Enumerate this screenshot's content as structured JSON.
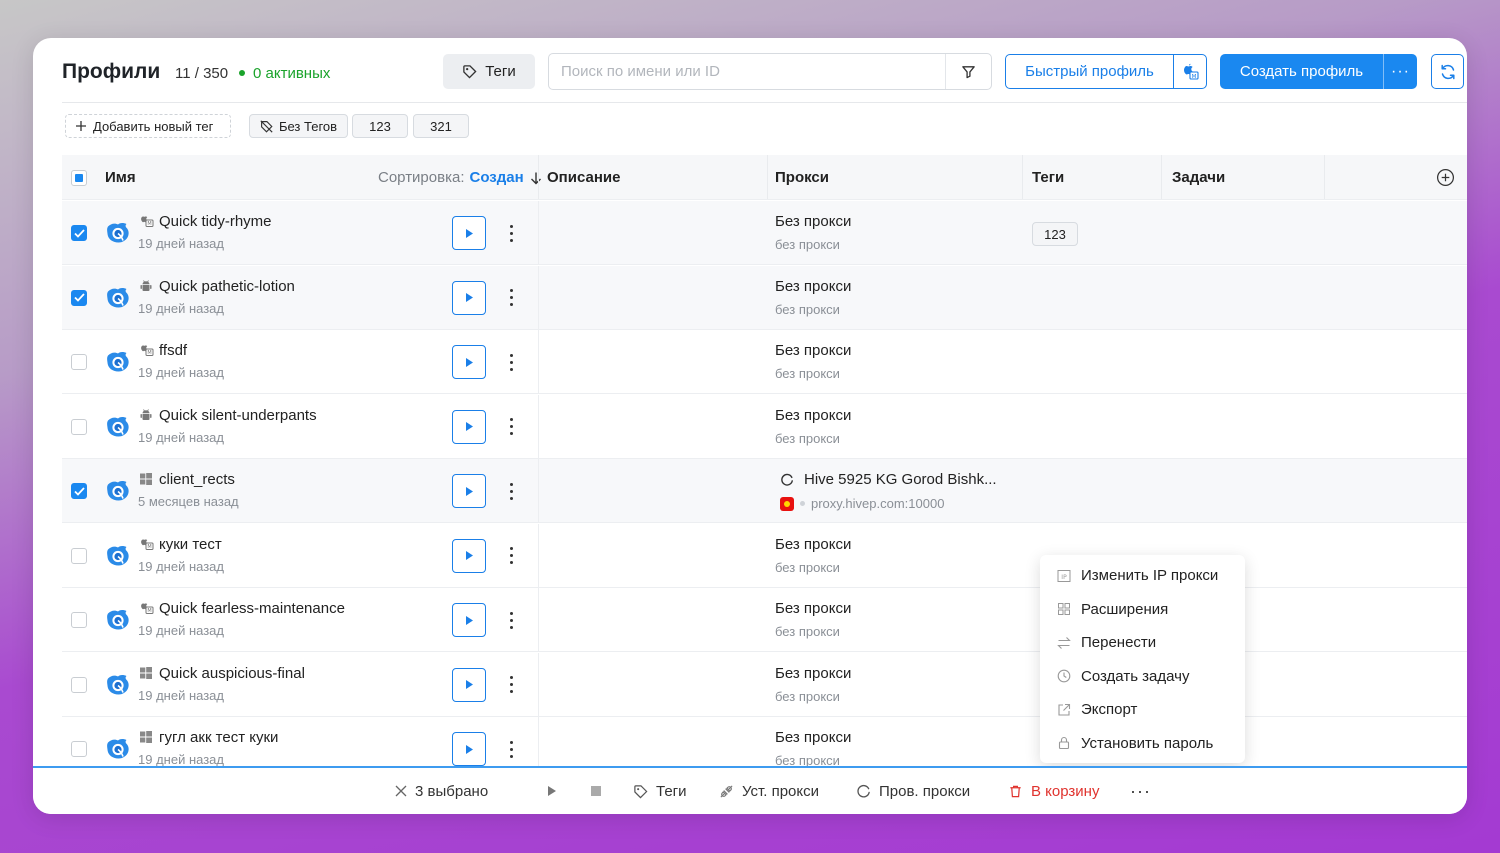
{
  "header": {
    "title": "Профили",
    "count": "11 / 350",
    "active": "0 активных",
    "tags_button": "Теги",
    "search_placeholder": "Поиск по имени или ID",
    "quick_profile": "Быстрый профиль",
    "create_profile": "Создать профиль",
    "create_more": "···"
  },
  "tagbar": {
    "add_tag": "Добавить новый тег",
    "no_tags": "Без Тегов",
    "tags": [
      "123",
      "321"
    ]
  },
  "table": {
    "columns": {
      "name": "Имя",
      "sort_label": "Сортировка:",
      "sort_value": "Создан",
      "description": "Описание",
      "proxy": "Прокси",
      "tags": "Теги",
      "tasks": "Задачи"
    },
    "rows": [
      {
        "name": "Quick tidy-rhyme",
        "date": "19 дней назад",
        "proxy": "Без прокси",
        "proxy_sub": "без прокси",
        "tag": "123",
        "checked": true,
        "os": "mac-icon"
      },
      {
        "name": "Quick pathetic-lotion",
        "date": "19 дней назад",
        "proxy": "Без прокси",
        "proxy_sub": "без прокси",
        "tag": "",
        "checked": true,
        "os": "android-icon"
      },
      {
        "name": "ffsdf",
        "date": "19 дней назад",
        "proxy": "Без прокси",
        "proxy_sub": "без прокси",
        "tag": "",
        "checked": false,
        "os": "mac-icon"
      },
      {
        "name": "Quick silent-underpants",
        "date": "19 дней назад",
        "proxy": "Без прокси",
        "proxy_sub": "без прокси",
        "tag": "",
        "checked": false,
        "os": "android-icon"
      },
      {
        "name": "client_rects",
        "date": "5 месяцев назад",
        "proxy": "Hive 5925 KG Gorod Bishk...",
        "proxy_sub": "proxy.hivep.com:10000",
        "tag": "",
        "checked": true,
        "os": "windows-icon"
      },
      {
        "name": "куки тест",
        "date": "19 дней назад",
        "proxy": "Без прокси",
        "proxy_sub": "без прокси",
        "tag": "",
        "checked": false,
        "os": "mac-icon"
      },
      {
        "name": "Quick fearless-maintenance",
        "date": "19 дней назад",
        "proxy": "Без прокси",
        "proxy_sub": "без прокси",
        "tag": "",
        "checked": false,
        "os": "mac-icon"
      },
      {
        "name": "Quick auspicious-final",
        "date": "19 дней назад",
        "proxy": "Без прокси",
        "proxy_sub": "без прокси",
        "tag": "",
        "checked": false,
        "os": "windows-icon"
      },
      {
        "name": "гугл акк тест куки",
        "date": "19 дней назад",
        "proxy": "Без прокси",
        "proxy_sub": "без прокси",
        "tag": "",
        "checked": false,
        "os": "windows-icon"
      }
    ]
  },
  "context_menu": {
    "items": [
      "Изменить IP прокси",
      "Расширения",
      "Перенести",
      "Создать задачу",
      "Экспорт",
      "Установить пароль"
    ]
  },
  "bottombar": {
    "selected": "3 выбрано",
    "tags": "Теги",
    "set_proxy": "Уст. прокси",
    "check_proxy": "Пров. прокси",
    "trash": "В корзину",
    "more": "···"
  },
  "colors": {
    "accent": "#1a88f0",
    "active_green": "#1aa32b",
    "danger": "#e0332e"
  }
}
